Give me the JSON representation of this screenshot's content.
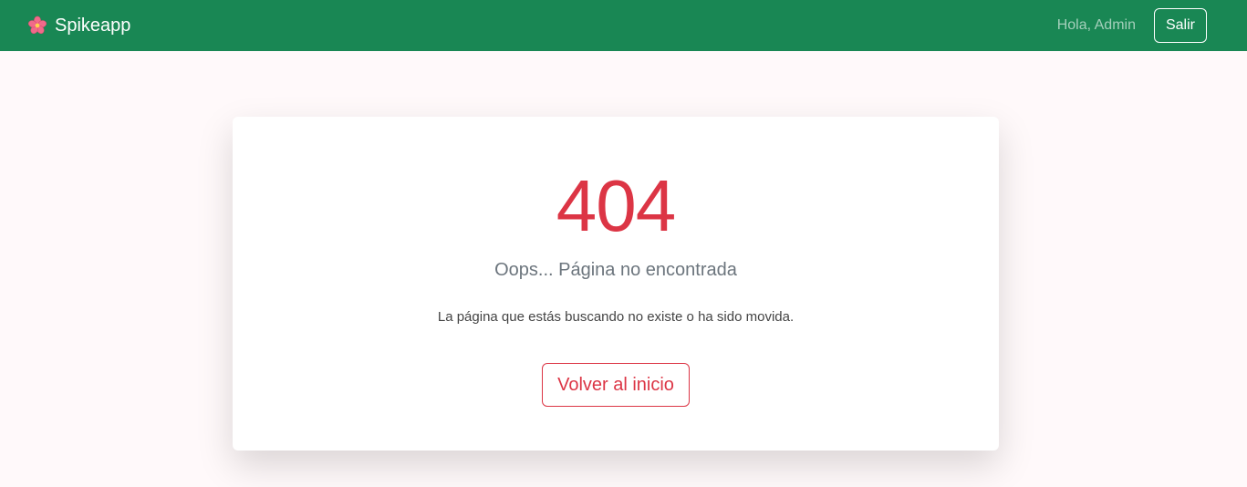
{
  "navbar": {
    "brand_icon": "sakura-flower-icon",
    "brand_label": "Spikeapp",
    "greeting": "Hola, Admin",
    "logout_label": "Salir",
    "background_color": "#198754"
  },
  "error": {
    "code": "404",
    "subtitle": "Oops... Página no encontrada",
    "description": "La página que estás buscando no existe o ha sido movida.",
    "home_button_label": "Volver al inicio",
    "accent_color": "#dc3545"
  }
}
